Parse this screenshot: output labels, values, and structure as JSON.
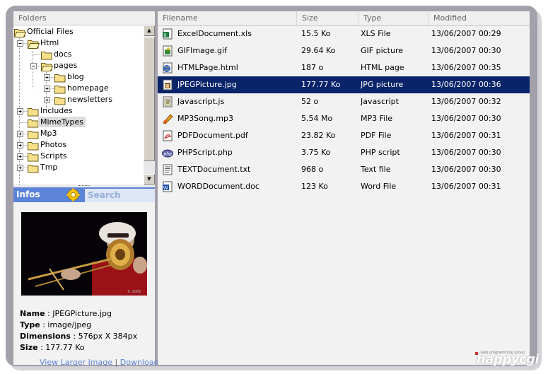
{
  "folders_header": "Folders",
  "tree": [
    {
      "label": "Official Files",
      "level": 0,
      "expander": "none",
      "icon": "folder-open"
    },
    {
      "label": "Html",
      "level": 1,
      "expander": "minus",
      "icon": "folder-open"
    },
    {
      "label": "docs",
      "level": 2,
      "expander": "none",
      "icon": "folder"
    },
    {
      "label": "pages",
      "level": 2,
      "expander": "minus",
      "icon": "folder-open"
    },
    {
      "label": "blog",
      "level": 3,
      "expander": "plus",
      "icon": "folder"
    },
    {
      "label": "homepage",
      "level": 3,
      "expander": "plus",
      "icon": "folder"
    },
    {
      "label": "newsletters",
      "level": 3,
      "expander": "plus",
      "icon": "folder"
    },
    {
      "label": "Includes",
      "level": 1,
      "expander": "plus",
      "icon": "folder"
    },
    {
      "label": "MimeTypes",
      "level": 1,
      "expander": "none",
      "icon": "folder",
      "selected": true
    },
    {
      "label": "Mp3",
      "level": 1,
      "expander": "plus",
      "icon": "folder"
    },
    {
      "label": "Photos",
      "level": 1,
      "expander": "plus",
      "icon": "folder"
    },
    {
      "label": "Scripts",
      "level": 1,
      "expander": "plus",
      "icon": "folder"
    },
    {
      "label": "Tmp",
      "level": 1,
      "expander": "plus",
      "icon": "folder"
    }
  ],
  "infos": {
    "tab_label": "Infos",
    "search_label": "Search",
    "settings_icon": "gear-icon"
  },
  "details": {
    "name_label": "Name",
    "name_value": ": JPEGPicture.jpg",
    "type_label": "Type",
    "type_value": ": image/jpeg",
    "dim_label": "Dimensions",
    "dim_value": ": 576px X 384px",
    "size_label": "Size",
    "size_value": ": 177.77 Ko",
    "view_larger": "View Larger Image",
    "separator": "|",
    "download": "Download"
  },
  "columns": [
    "Filename",
    "Size",
    "Type",
    "Modified"
  ],
  "files": [
    {
      "name": "ExcelDocument.xls",
      "size": "15.5 Ko",
      "type": "XLS File",
      "modified": "13/06/2007 00:29",
      "icon": "excel-file-icon"
    },
    {
      "name": "GIFImage.gif",
      "size": "29.64 Ko",
      "type": "GIF picture",
      "modified": "13/06/2007 00:30",
      "icon": "gif-file-icon"
    },
    {
      "name": "HTMLPage.html",
      "size": "187 o",
      "type": "HTML page",
      "modified": "13/06/2007 00:35",
      "icon": "html-file-icon"
    },
    {
      "name": "JPEGPicture.jpg",
      "size": "177.77 Ko",
      "type": "JPG picture",
      "modified": "13/06/2007 00:36",
      "icon": "jpeg-file-icon",
      "selected": true
    },
    {
      "name": "Javascript.js",
      "size": "52 o",
      "type": "Javascript",
      "modified": "13/06/2007 00:32",
      "icon": "javascript-file-icon"
    },
    {
      "name": "MP3Song.mp3",
      "size": "5.54 Mo",
      "type": "MP3 File",
      "modified": "13/06/2007 00:30",
      "icon": "mp3-file-icon"
    },
    {
      "name": "PDFDocument.pdf",
      "size": "23.82 Ko",
      "type": "PDF File",
      "modified": "13/06/2007 00:31",
      "icon": "pdf-file-icon"
    },
    {
      "name": "PHPScript.php",
      "size": "3.75 Ko",
      "type": "PHP script",
      "modified": "13/06/2007 00:30",
      "icon": "php-file-icon"
    },
    {
      "name": "TEXTDocument.txt",
      "size": "968 o",
      "type": "Text file",
      "modified": "13/06/2007 00:30",
      "icon": "text-file-icon"
    },
    {
      "name": "WORDDocument.doc",
      "size": "123 Ko",
      "type": "Word File",
      "modified": "13/06/2007 00:31",
      "icon": "word-file-icon"
    }
  ],
  "logo": {
    "tagline": "web programming group",
    "brand": "happycgi"
  },
  "colors": {
    "frame": "#a4a0a9",
    "selection": "#0a246a",
    "infos_bar": "#5b83d8",
    "link": "#5b83d8"
  }
}
